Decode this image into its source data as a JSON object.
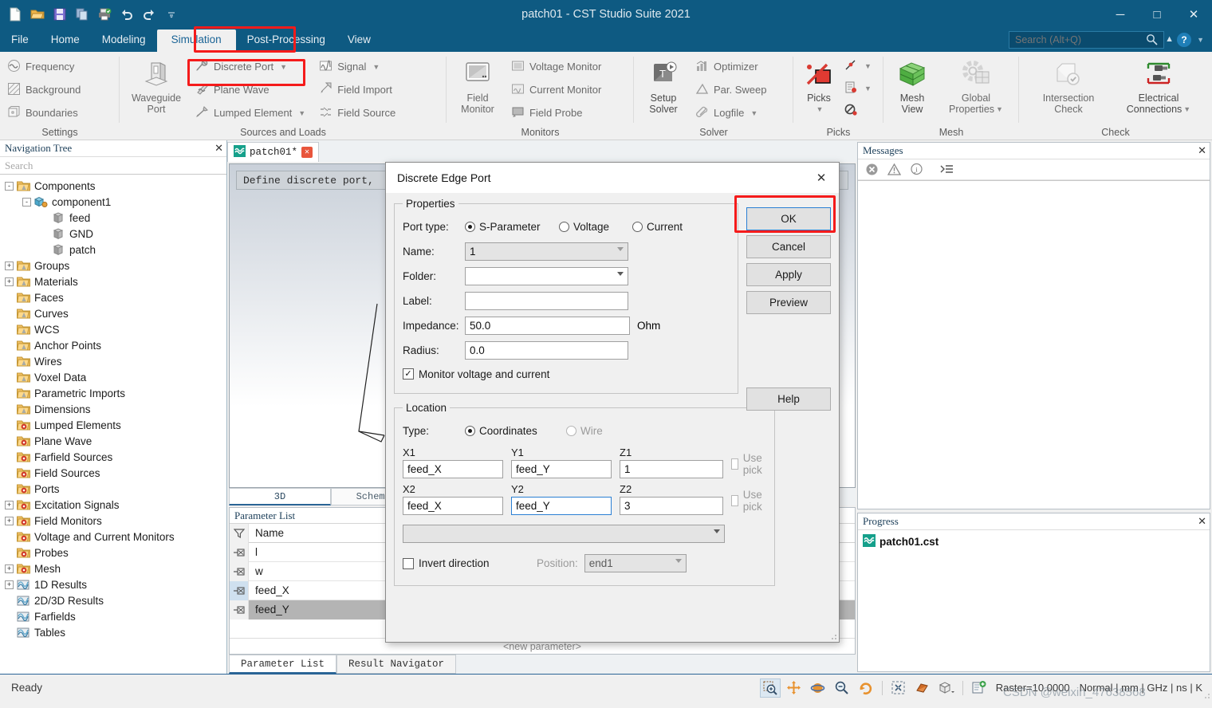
{
  "titlebar": {
    "title": "patch01 - CST Studio Suite 2021",
    "quick_access": [
      "new-icon",
      "open-icon",
      "save-icon",
      "copy-icon",
      "print-icon",
      "undo-icon",
      "redo-icon",
      "qat-more-icon"
    ],
    "minimize": "─",
    "maximize": "□",
    "close": "✕"
  },
  "menubar": {
    "tabs": [
      {
        "label": "File",
        "active": false
      },
      {
        "label": "Home",
        "active": false
      },
      {
        "label": "Modeling",
        "active": false
      },
      {
        "label": "Simulation",
        "active": true
      },
      {
        "label": "Post-Processing",
        "active": false
      },
      {
        "label": "View",
        "active": false
      }
    ],
    "search_placeholder": "Search (Alt+Q)",
    "help_label": "?"
  },
  "ribbon": {
    "groups": [
      {
        "caption": "Settings",
        "small_items": [
          {
            "label": "Frequency",
            "icon": "frequency-icon"
          },
          {
            "label": "Background",
            "icon": "background-icon"
          },
          {
            "label": "Boundaries",
            "icon": "boundaries-icon"
          }
        ]
      },
      {
        "caption": "Sources and Loads",
        "big_items": [
          {
            "label1": "Waveguide",
            "label2": "Port",
            "icon": "waveguide-port-icon"
          }
        ],
        "small_items": [
          {
            "label": "Discrete Port",
            "icon": "discrete-port-icon",
            "dropdown": true,
            "highlighted": true
          },
          {
            "label": "Plane Wave",
            "icon": "plane-wave-icon",
            "dropdown": false
          },
          {
            "label": "Lumped Element",
            "icon": "lumped-element-icon",
            "dropdown": true
          },
          {
            "label": "Signal",
            "icon": "signal-icon",
            "dropdown": true
          },
          {
            "label": "Field Import",
            "icon": "field-import-icon",
            "dropdown": false
          },
          {
            "label": "Field Source",
            "icon": "field-source-icon",
            "dropdown": false
          }
        ]
      },
      {
        "caption": "Monitors",
        "big_items": [
          {
            "label1": "Field",
            "label2": "Monitor",
            "icon": "field-monitor-icon"
          }
        ],
        "small_items": [
          {
            "label": "Voltage Monitor",
            "icon": "voltage-monitor-icon"
          },
          {
            "label": "Current Monitor",
            "icon": "current-monitor-icon"
          },
          {
            "label": "Field Probe",
            "icon": "field-probe-icon"
          }
        ]
      },
      {
        "caption": "Solver",
        "big_items": [
          {
            "label1": "Setup",
            "label2": "Solver",
            "icon": "setup-solver-icon"
          }
        ],
        "small_items": [
          {
            "label": "Optimizer",
            "icon": "optimizer-icon",
            "dropdown": false
          },
          {
            "label": "Par. Sweep",
            "icon": "par-sweep-icon",
            "dropdown": false
          },
          {
            "label": "Logfile",
            "icon": "logfile-icon",
            "dropdown": true
          }
        ]
      },
      {
        "caption": "Picks",
        "big_items": [
          {
            "label1": "Picks",
            "label2": "",
            "icon": "picks-icon",
            "dropdown": true
          }
        ],
        "small_items": [
          {
            "label": "",
            "icon": "pick-edge-icon",
            "dropdown": true
          },
          {
            "label": "",
            "icon": "pick-list-icon",
            "dropdown": true
          },
          {
            "label": "",
            "icon": "clear-picks-icon",
            "dropdown": false
          }
        ]
      },
      {
        "caption": "Mesh",
        "big_items": [
          {
            "label1": "Mesh",
            "label2": "View",
            "icon": "mesh-view-icon"
          },
          {
            "label1": "Global",
            "label2": "Properties",
            "icon": "global-properties-icon",
            "dropdown": true
          }
        ]
      },
      {
        "caption": "Check",
        "big_items": [
          {
            "label1": "Intersection",
            "label2": "Check",
            "icon": "intersection-check-icon"
          },
          {
            "label1": "Electrical",
            "label2": "Connections",
            "icon": "electrical-connections-icon",
            "dropdown": true
          }
        ]
      }
    ]
  },
  "navtree": {
    "title": "Navigation Tree",
    "search_placeholder": "Search",
    "items": [
      {
        "label": "Components",
        "depth": 0,
        "expander": "-",
        "icon": "folder-shape-icon"
      },
      {
        "label": "component1",
        "depth": 1,
        "expander": "-",
        "icon": "component-icon"
      },
      {
        "label": "feed",
        "depth": 2,
        "expander": "",
        "icon": "solid-icon"
      },
      {
        "label": "GND",
        "depth": 2,
        "expander": "",
        "icon": "solid-icon"
      },
      {
        "label": "patch",
        "depth": 2,
        "expander": "",
        "icon": "solid-icon"
      },
      {
        "label": "Groups",
        "depth": 0,
        "expander": "+",
        "icon": "folder-shape-icon"
      },
      {
        "label": "Materials",
        "depth": 0,
        "expander": "+",
        "icon": "folder-shape-icon"
      },
      {
        "label": "Faces",
        "depth": 0,
        "expander": "",
        "icon": "folder-shape-icon"
      },
      {
        "label": "Curves",
        "depth": 0,
        "expander": "",
        "icon": "folder-shape-icon"
      },
      {
        "label": "WCS",
        "depth": 0,
        "expander": "",
        "icon": "folder-shape-icon"
      },
      {
        "label": "Anchor Points",
        "depth": 0,
        "expander": "",
        "icon": "folder-shape-icon"
      },
      {
        "label": "Wires",
        "depth": 0,
        "expander": "",
        "icon": "folder-shape-icon"
      },
      {
        "label": "Voxel Data",
        "depth": 0,
        "expander": "",
        "icon": "folder-shape-icon"
      },
      {
        "label": "Parametric Imports",
        "depth": 0,
        "expander": "",
        "icon": "folder-shape-icon"
      },
      {
        "label": "Dimensions",
        "depth": 0,
        "expander": "",
        "icon": "folder-shape-icon"
      },
      {
        "label": "Lumped Elements",
        "depth": 0,
        "expander": "",
        "icon": "folder-gear-icon"
      },
      {
        "label": "Plane Wave",
        "depth": 0,
        "expander": "",
        "icon": "folder-gear-icon"
      },
      {
        "label": "Farfield Sources",
        "depth": 0,
        "expander": "",
        "icon": "folder-gear-icon"
      },
      {
        "label": "Field Sources",
        "depth": 0,
        "expander": "",
        "icon": "folder-gear-icon"
      },
      {
        "label": "Ports",
        "depth": 0,
        "expander": "",
        "icon": "folder-gear-icon"
      },
      {
        "label": "Excitation Signals",
        "depth": 0,
        "expander": "+",
        "icon": "folder-gear-icon"
      },
      {
        "label": "Field Monitors",
        "depth": 0,
        "expander": "+",
        "icon": "folder-gear-icon"
      },
      {
        "label": "Voltage and Current Monitors",
        "depth": 0,
        "expander": "",
        "icon": "folder-gear-icon"
      },
      {
        "label": "Probes",
        "depth": 0,
        "expander": "",
        "icon": "folder-gear-icon"
      },
      {
        "label": "Mesh",
        "depth": 0,
        "expander": "+",
        "icon": "folder-gear-icon"
      },
      {
        "label": "1D Results",
        "depth": 0,
        "expander": "+",
        "icon": "results-icon"
      },
      {
        "label": "2D/3D Results",
        "depth": 0,
        "expander": "",
        "icon": "results-icon"
      },
      {
        "label": "Farfields",
        "depth": 0,
        "expander": "",
        "icon": "results-icon"
      },
      {
        "label": "Tables",
        "depth": 0,
        "expander": "",
        "icon": "results-icon"
      }
    ]
  },
  "center": {
    "doc_tab": "patch01*",
    "doc_tab_close": "✕",
    "viewport_hint": "Define discrete port,",
    "view_tabs": [
      {
        "label": "3D",
        "active": true
      },
      {
        "label": "Schematic",
        "active": false
      }
    ],
    "parameter_list": {
      "title": "Parameter List",
      "columns": [
        "Name"
      ],
      "rows": [
        {
          "name": "l",
          "selected": false
        },
        {
          "name": "w",
          "selected": false
        },
        {
          "name": "feed_X",
          "selected": false
        },
        {
          "name": "feed_Y",
          "selected": true
        }
      ],
      "new_parameter": "<new parameter>"
    },
    "bottom_tabs": [
      {
        "label": "Parameter List",
        "active": true
      },
      {
        "label": "Result Navigator",
        "active": false
      }
    ]
  },
  "right": {
    "messages": {
      "title": "Messages",
      "tools": [
        "error-icon",
        "warning-icon",
        "info-icon",
        "clear-messages-icon"
      ],
      "content": ""
    },
    "progress": {
      "title": "Progress",
      "items": [
        {
          "label": "patch01.cst",
          "icon": "cst-file-icon"
        }
      ]
    }
  },
  "dialog": {
    "title": "Discrete Edge Port",
    "close": "✕",
    "properties": {
      "legend": "Properties",
      "port_type_label": "Port type:",
      "port_type_options": [
        {
          "label": "S-Parameter",
          "selected": true
        },
        {
          "label": "Voltage",
          "selected": false
        },
        {
          "label": "Current",
          "selected": false
        }
      ],
      "name_label": "Name:",
      "name_value": "1",
      "folder_label": "Folder:",
      "folder_value": "",
      "label_label": "Label:",
      "label_value": "",
      "impedance_label": "Impedance:",
      "impedance_value": "50.0",
      "impedance_unit": "Ohm",
      "radius_label": "Radius:",
      "radius_value": "0.0",
      "monitor_checkbox": "Monitor voltage and current",
      "monitor_checked": true
    },
    "location": {
      "legend": "Location",
      "type_label": "Type:",
      "type_options": [
        {
          "label": "Coordinates",
          "selected": true,
          "disabled": false
        },
        {
          "label": "Wire",
          "selected": false,
          "disabled": true
        }
      ],
      "fields": [
        {
          "label": "X1",
          "value": "feed_X",
          "focused": false
        },
        {
          "label": "Y1",
          "value": "feed_Y",
          "focused": false
        },
        {
          "label": "Z1",
          "value": "1",
          "focused": false
        },
        {
          "label": "X2",
          "value": "feed_X",
          "focused": false
        },
        {
          "label": "Y2",
          "value": "feed_Y",
          "focused": true
        },
        {
          "label": "Z2",
          "value": "3",
          "focused": false
        }
      ],
      "use_pick_1": "Use pick",
      "use_pick_2": "Use pick",
      "wire_select_value": "",
      "invert_label": "Invert direction",
      "invert_checked": false,
      "position_label": "Position:",
      "position_value": "end1"
    },
    "buttons": [
      {
        "label": "OK",
        "default": true,
        "highlighted": true
      },
      {
        "label": "Cancel",
        "default": false
      },
      {
        "label": "Apply",
        "default": false
      },
      {
        "label": "Preview",
        "default": false
      }
    ],
    "help_button": "Help"
  },
  "statusbar": {
    "ready": "Ready",
    "icons": [
      "zoom-select-icon",
      "pan-icon",
      "rotate-icon",
      "zoom-out-icon",
      "rotate-view-icon",
      "fit-view-icon",
      "perspective-icon",
      "view-cube-icon",
      "snapshot-icon"
    ],
    "raster": "Raster=10.0000",
    "units": "Normal | mm | GHz | ns | K",
    "watermark": "CSDN @weixin_47638568"
  },
  "colors": {
    "titlebar_blue": "#0e5a82",
    "accent_blue": "#2a6496",
    "highlight_red": "#f51b1b",
    "focus_blue": "#2a7fd4",
    "folder_yellow": "#e9b84a",
    "teal": "#15a08b"
  }
}
